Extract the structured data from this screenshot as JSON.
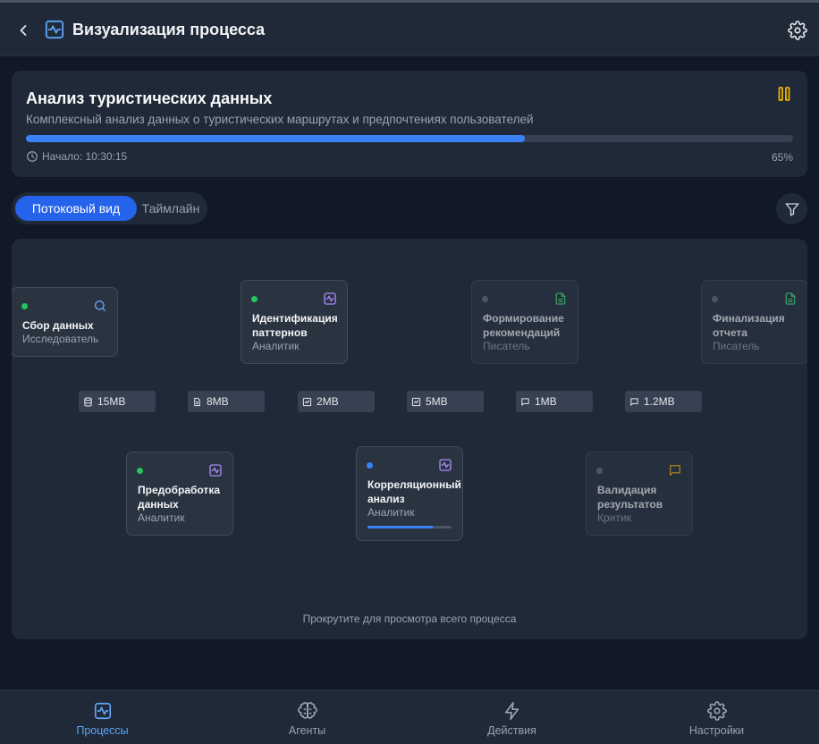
{
  "header": {
    "title": "Визуализация процесса",
    "icons": {
      "back": "chevron-left-icon",
      "title": "activity-icon",
      "settings": "gear-icon"
    }
  },
  "process": {
    "title": "Анализ туристических данных",
    "description": "Комплексный анализ данных о туристических маршрутах и предпочтениях пользователей",
    "progress_percent": 65,
    "progress_label": "65%",
    "start_label": "Начало: 10:30:15",
    "accent": "#3b82f6",
    "pause_color": "#eab308"
  },
  "view_toggle": {
    "options": [
      "Потоковый вид",
      "Таймлайн"
    ],
    "selected": "Потоковый вид"
  },
  "flow": {
    "nodes": [
      {
        "name": "Сбор данных",
        "role": "Исследователь",
        "status": "completed",
        "icon": "search-icon",
        "status_color": "#22c55e",
        "icon_color": "#60a5fa"
      },
      {
        "name": "Предобработка данных",
        "role": "Аналитик",
        "status": "completed",
        "icon": "activity-icon",
        "status_color": "#22c55e",
        "icon_color": "#a78bfa"
      },
      {
        "name": "Идентификация паттернов",
        "role": "Аналитик",
        "status": "completed",
        "icon": "activity-icon",
        "status_color": "#22c55e",
        "icon_color": "#a78bfa"
      },
      {
        "name": "Корреляционный анализ",
        "role": "Аналитик",
        "status": "in-progress",
        "icon": "activity-icon",
        "status_color": "#3b82f6",
        "icon_color": "#a78bfa",
        "progress": 0.78
      },
      {
        "name": "Формирование рекомендаций",
        "role": "Писатель",
        "status": "pending",
        "icon": "document-icon",
        "status_color": "#6b7280",
        "icon_color": "#4ade80"
      },
      {
        "name": "Валидация результатов",
        "role": "Критик",
        "status": "pending",
        "icon": "chat-icon",
        "status_color": "#6b7280",
        "icon_color": "#eab308"
      },
      {
        "name": "Финализация отчета",
        "role": "Писатель",
        "status": "pending",
        "icon": "document-icon",
        "status_color": "#6b7280",
        "icon_color": "#4ade80"
      }
    ],
    "transfers": [
      {
        "size": "15MB",
        "icon": "database-icon"
      },
      {
        "size": "8MB",
        "icon": "file-icon"
      },
      {
        "size": "2MB",
        "icon": "chart-icon"
      },
      {
        "size": "5MB",
        "icon": "chart-icon"
      },
      {
        "size": "1MB",
        "icon": "message-icon"
      },
      {
        "size": "1.2MB",
        "icon": "message-icon"
      }
    ],
    "hint": "Прокрутите для просмотра всего процесса"
  },
  "bottom_nav": {
    "items": [
      {
        "label": "Процессы",
        "icon": "activity-icon",
        "active": true
      },
      {
        "label": "Агенты",
        "icon": "brain-icon",
        "active": false
      },
      {
        "label": "Действия",
        "icon": "lightning-icon",
        "active": false
      },
      {
        "label": "Настройки",
        "icon": "gear-icon",
        "active": false
      }
    ]
  }
}
